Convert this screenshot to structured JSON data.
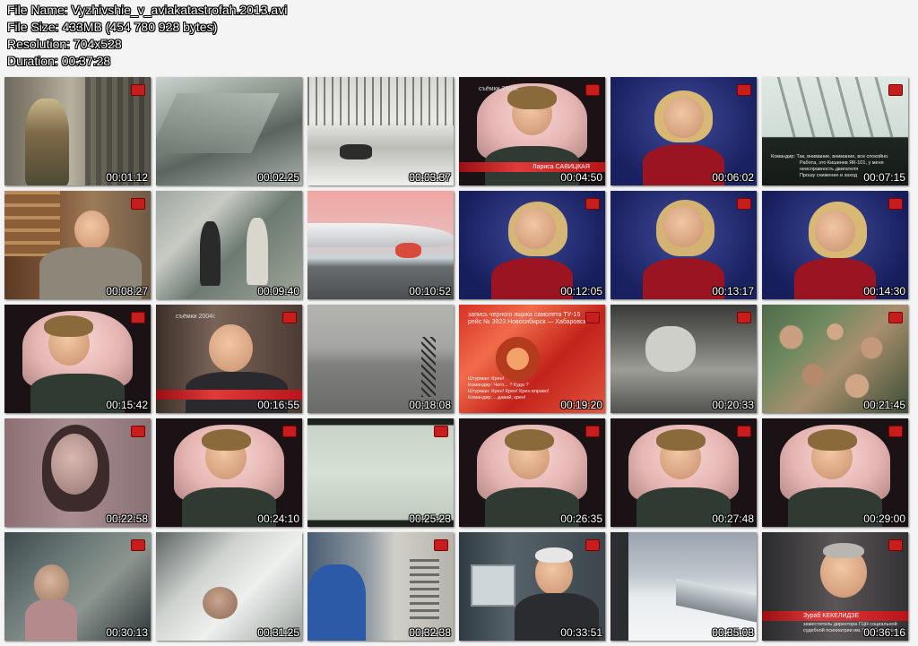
{
  "file_info": {
    "file_name": "File Name: Vyzhivshie_v_aviakatastrofah.2013.avi",
    "file_size": "File Size: 433MB (454 780 928 bytes)",
    "resolution": "Resolution: 704x528",
    "duration": "Duration: 00:37:28"
  },
  "thumbnails": [
    {
      "time": "00:01:12"
    },
    {
      "time": "00:02:25"
    },
    {
      "time": "00:03:37"
    },
    {
      "time": "00:04:50",
      "overlay_top": "съёмки 2004г.",
      "overlay_name": "Лариса САВИЦКАЯ"
    },
    {
      "time": "00:06:02"
    },
    {
      "time": "00:07:15",
      "caption_lines": [
        "Командир: Так, внимание, внимание, все спокойно.",
        "Работа, это Кишинев ЯК-101, у меня",
        "неисправность двигателя",
        "Прошу снижение и заход"
      ]
    },
    {
      "time": "00:08:27"
    },
    {
      "time": "00:09:40"
    },
    {
      "time": "00:10:52"
    },
    {
      "time": "00:12:05"
    },
    {
      "time": "00:13:17"
    },
    {
      "time": "00:14:30"
    },
    {
      "time": "00:15:42"
    },
    {
      "time": "00:16:55",
      "overlay_top": "съёмки 2004г."
    },
    {
      "time": "00:18:08"
    },
    {
      "time": "00:19:20",
      "caption_lines": [
        "запись черного ящика самолета ТУ-15",
        "рейс № 3923 Новосибирск — Хабаровск"
      ],
      "dialog_lines": [
        "Штурман: Крен!",
        "Командир: Чего... ? Куда ?",
        "Штурман: Крен! Крен! Крен вправо!",
        "Командир: ...давай, крен!"
      ]
    },
    {
      "time": "00:20:33"
    },
    {
      "time": "00:21:45"
    },
    {
      "time": "00:22:58"
    },
    {
      "time": "00:24:10"
    },
    {
      "time": "00:25:23"
    },
    {
      "time": "00:26:35"
    },
    {
      "time": "00:27:48"
    },
    {
      "time": "00:29:00"
    },
    {
      "time": "00:30:13"
    },
    {
      "time": "00:31:25"
    },
    {
      "time": "00:32:38"
    },
    {
      "time": "00:33:51"
    },
    {
      "time": "00:35:03"
    },
    {
      "time": "00:36:16",
      "overlay_name": "Зураб КЕКЕЛИДЗЕ",
      "caption_lines": [
        "заместитель директора ГЦН социальной",
        "судебной психиатрии им. В.П. Сербского"
      ]
    }
  ],
  "colors": {
    "page_background": "#f4f4f4",
    "header_text": "#ffffff",
    "channel_red": "#c81d1d"
  }
}
